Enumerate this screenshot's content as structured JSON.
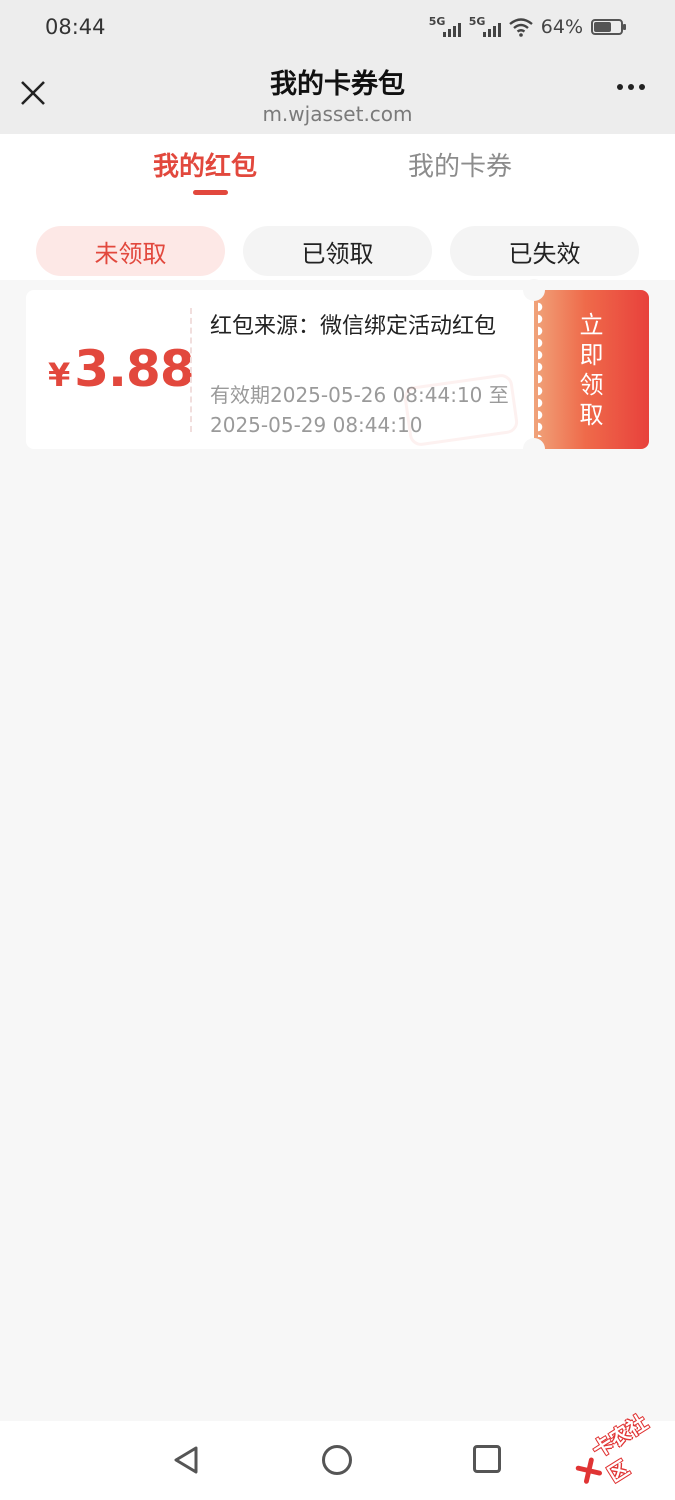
{
  "status_bar": {
    "time": "08:44",
    "signal1": "5G",
    "signal2": "5G",
    "battery": "64%",
    "battery_level": 0.64
  },
  "nav": {
    "title": "我的卡券包",
    "url": "m.wjasset.com"
  },
  "tabs": [
    {
      "label": "我的红包",
      "active": true
    },
    {
      "label": "我的卡券",
      "active": false
    }
  ],
  "filters": [
    {
      "label": "未领取",
      "active": true
    },
    {
      "label": "已领取",
      "active": false
    },
    {
      "label": "已失效",
      "active": false
    }
  ],
  "coupon": {
    "currency": "¥",
    "amount": "3.88",
    "source": "红包来源：微信绑定活动红包",
    "validity": "有效期2025-05-26 08:44:10 至 2025-05-29 08:44:10",
    "claim_label": "立即领取"
  },
  "watermark": "卡农社区",
  "colors": {
    "accent": "#e2483d",
    "background": "#f7f7f7",
    "header": "#ededed"
  }
}
